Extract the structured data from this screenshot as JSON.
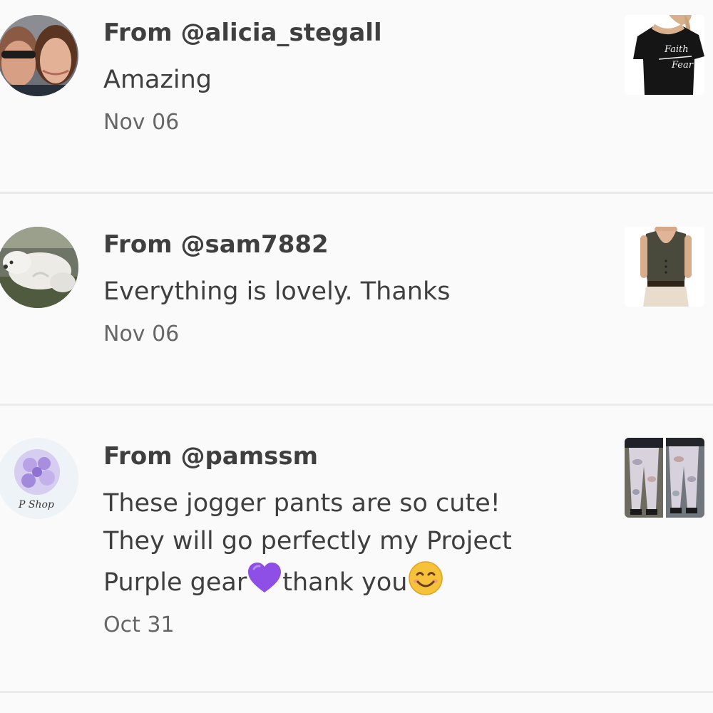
{
  "reviews": [
    {
      "from_prefix": "From ",
      "handle": "@alicia_stegall",
      "comment": "Amazing",
      "date": "Nov 06",
      "avatar_icon": "couple-photo-avatar",
      "thumb_icon": "black-tshirt-faith-over-fear"
    },
    {
      "from_prefix": "From ",
      "handle": "@sam7882",
      "comment": "Everything is lovely. Thanks",
      "date": "Nov 06",
      "avatar_icon": "white-dog-photo-avatar",
      "thumb_icon": "olive-tank-top-thumbnail"
    },
    {
      "from_prefix": "From ",
      "handle": "@pamssm",
      "comment_part1": "These jogger pants are so cute! They will go perfectly my Project Purple gear",
      "comment_part2": "thank you",
      "emoji_1": "purple-heart-emoji",
      "emoji_2": "smiling-face-emoji",
      "date": "Oct 31",
      "avatar_icon": "p-shop-purple-logo-avatar",
      "avatar_text": "P Shop",
      "thumb_icon": "camo-jogger-pants-thumbnail"
    }
  ],
  "colors": {
    "background": "#fafafa",
    "divider": "#ebebeb",
    "primary_text": "#3f3f3f",
    "secondary_text": "#666666",
    "purple": "#8e4fe6",
    "lavender": "#b9a3e6"
  }
}
